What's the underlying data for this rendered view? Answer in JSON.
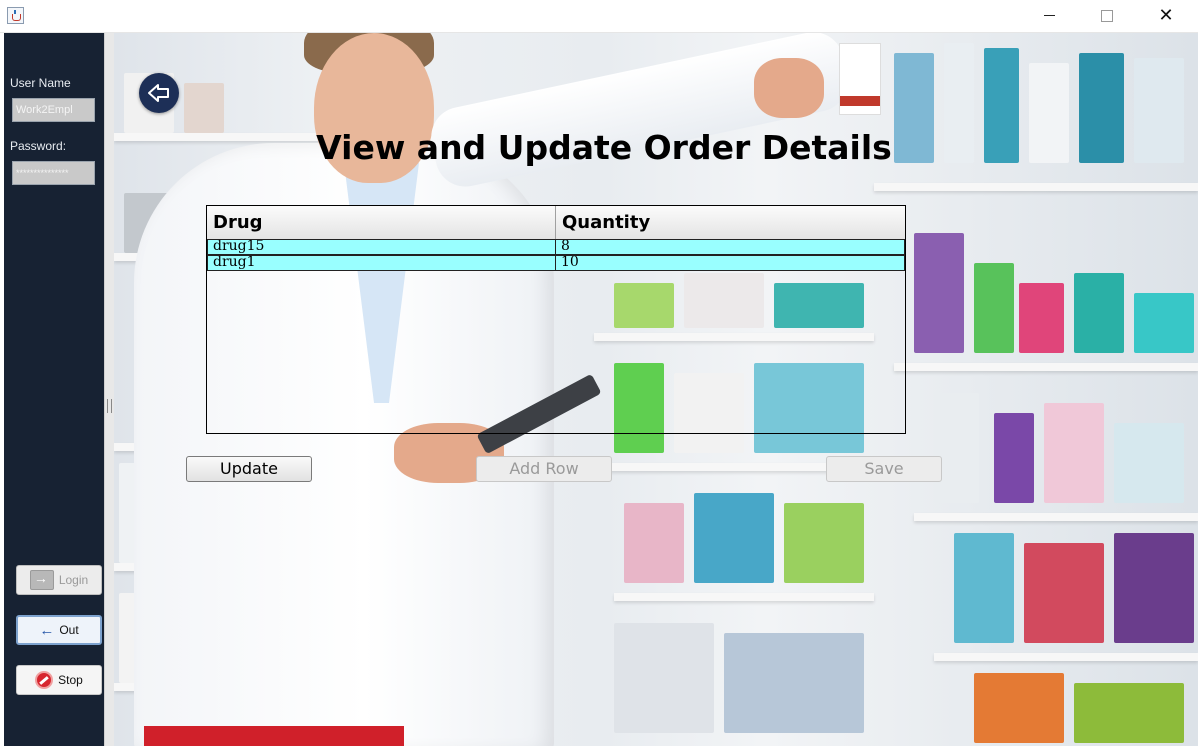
{
  "window": {
    "title": "",
    "close_glyph": "✕"
  },
  "sidebar": {
    "username_label": "User Name",
    "username_value": "Work2Empl",
    "password_label": "Password:",
    "password_value": "***************",
    "login_label": "Login",
    "out_label": "Out",
    "stop_label": "Stop"
  },
  "main": {
    "title": "View and Update Order Details",
    "table": {
      "columns": [
        "Drug",
        "Quantity"
      ],
      "rows": [
        [
          "drug15",
          "8"
        ],
        [
          "drug1",
          "10"
        ]
      ],
      "row_color": "#99ffff"
    },
    "buttons": {
      "update": "Update",
      "add_row": "Add Row",
      "save": "Save"
    }
  },
  "colors": {
    "sidebar_bg": "#172233",
    "back_button_bg": "#1d2f57"
  },
  "icons": [
    "java-app-icon",
    "back-arrow-icon",
    "login-arrow-icon",
    "out-arrow-icon",
    "stop-icon"
  ]
}
